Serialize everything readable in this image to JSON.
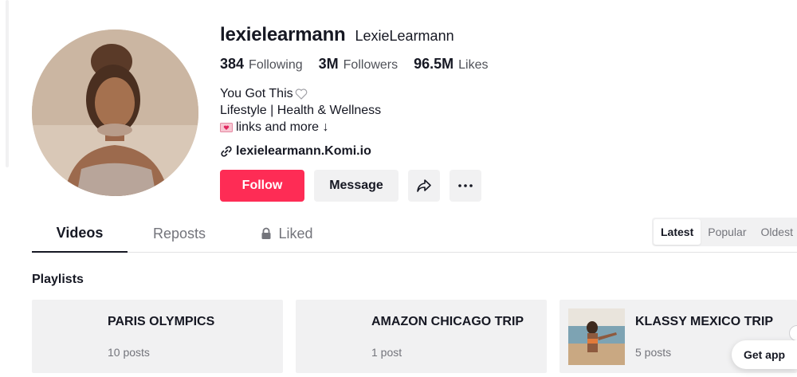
{
  "profile": {
    "username": "lexielearmann",
    "nickname": "LexieLearmann",
    "stats": [
      {
        "num": "384",
        "label": "Following"
      },
      {
        "num": "3M",
        "label": "Followers"
      },
      {
        "num": "96.5M",
        "label": "Likes"
      }
    ],
    "bio": {
      "line1": "You Got This",
      "line2": "Lifestyle | Health & Wellness",
      "line3": "links and more ↓"
    },
    "link": "lexielearmann.Komi.io"
  },
  "actions": {
    "follow": "Follow",
    "message": "Message"
  },
  "tabs": {
    "videos": "Videos",
    "reposts": "Reposts",
    "liked": "Liked"
  },
  "sort": {
    "latest": "Latest",
    "popular": "Popular",
    "oldest": "Oldest"
  },
  "playlists": {
    "heading": "Playlists",
    "items": [
      {
        "title": "PARIS OLYMPICS",
        "count": "10 posts"
      },
      {
        "title": "AMAZON CHICAGO TRIP",
        "count": "1 post"
      },
      {
        "title": "KLASSY MEXICO TRIP",
        "count": "5 posts"
      }
    ]
  },
  "get_app": "Get app",
  "icons": {
    "share": "share-arrow-icon",
    "more": "more-dots-icon",
    "lock": "lock-icon",
    "link": "link-icon",
    "heart": "heart-outline-icon",
    "mail": "love-letter-icon"
  },
  "colors": {
    "accent": "#fe2c55",
    "button_bg": "#f1f1f2",
    "text": "#161823",
    "muted": "#73747b"
  }
}
